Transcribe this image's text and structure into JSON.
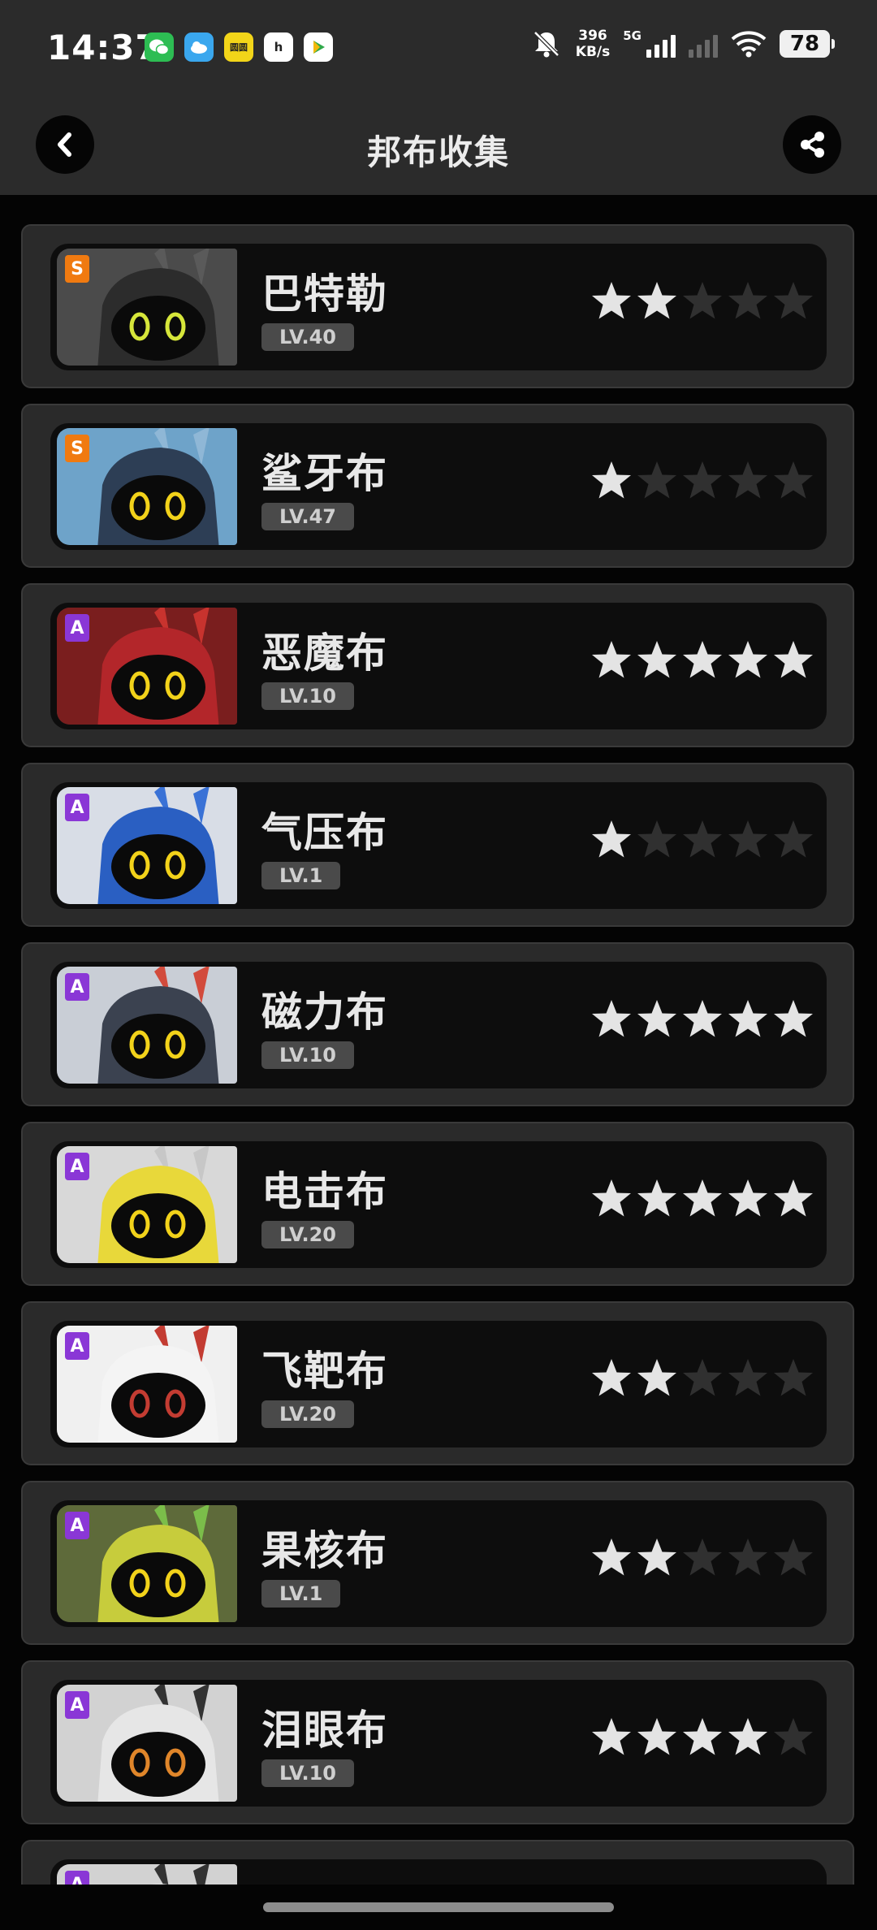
{
  "status_bar": {
    "time": "14:37",
    "net_speed_value": "396",
    "net_speed_unit": "KB/s",
    "network": "5G",
    "battery": "78",
    "app_icons": [
      "wechat-icon",
      "cloud-app-icon",
      "ticket-app-icon",
      "h-app-icon",
      "play-app-icon"
    ],
    "ticket_label": "圆圆",
    "h_label": "h"
  },
  "header": {
    "title": "邦布收集",
    "back_icon": "chevron-left-icon",
    "share_icon": "share-icon"
  },
  "colors": {
    "background": "#040404",
    "card": "#2a2a2a",
    "inner": "#0d0d0d",
    "rank_S": "#f07a10",
    "rank_A": "#8a37d6",
    "star_on": "#e4e4e4",
    "star_off": "#303030"
  },
  "bangboo": [
    {
      "name": "巴特勒",
      "level": "LV.40",
      "rank": "S",
      "stars": 2,
      "portrait": "butler-portrait"
    },
    {
      "name": "鲨牙布",
      "level": "LV.47",
      "rank": "S",
      "stars": 1,
      "portrait": "sharkboo-portrait"
    },
    {
      "name": "恶魔布",
      "level": "LV.10",
      "rank": "A",
      "stars": 5,
      "portrait": "devilboo-portrait"
    },
    {
      "name": "气压布",
      "level": "LV.1",
      "rank": "A",
      "stars": 1,
      "portrait": "airboo-portrait"
    },
    {
      "name": "磁力布",
      "level": "LV.10",
      "rank": "A",
      "stars": 5,
      "portrait": "magnetboo-portrait"
    },
    {
      "name": "电击布",
      "level": "LV.20",
      "rank": "A",
      "stars": 5,
      "portrait": "electroboo-portrait"
    },
    {
      "name": "飞靶布",
      "level": "LV.20",
      "rank": "A",
      "stars": 2,
      "portrait": "targetboo-portrait"
    },
    {
      "name": "果核布",
      "level": "LV.1",
      "rank": "A",
      "stars": 2,
      "portrait": "fruitboo-portrait"
    },
    {
      "name": "泪眼布",
      "level": "LV.10",
      "rank": "A",
      "stars": 4,
      "portrait": "tearboo-portrait"
    },
    {
      "name": "",
      "level": "",
      "rank": "A",
      "stars": 0,
      "portrait": "partial-portrait"
    }
  ]
}
